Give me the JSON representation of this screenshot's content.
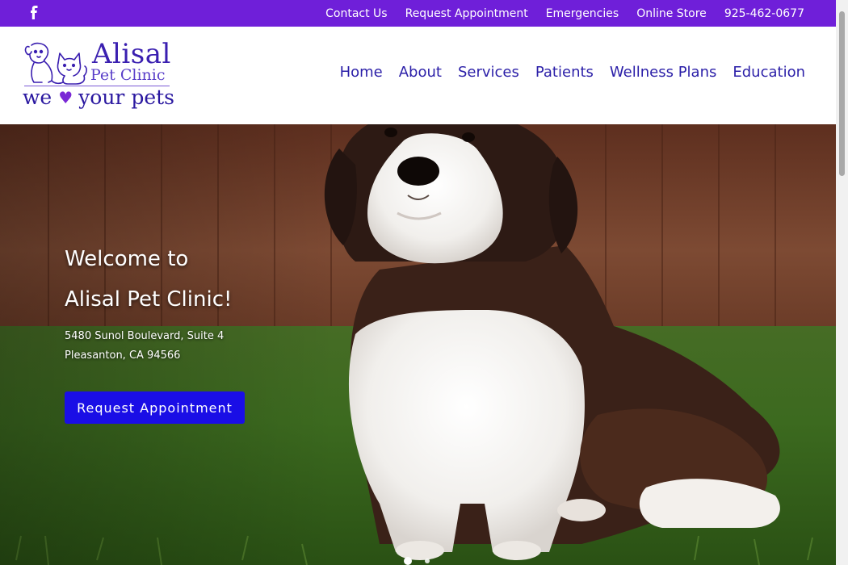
{
  "topbar": {
    "background": "#6f1fd9",
    "facebook_icon": "facebook-icon",
    "links": [
      "Contact Us",
      "Request Appointment",
      "Emergencies",
      "Online Store",
      "925-462-0677"
    ]
  },
  "logo": {
    "name": "Alisal",
    "subtitle": "Pet Clinic",
    "tagline_before": "we",
    "heart_icon": "heart-icon",
    "tagline_after": "your pets",
    "color": "#3a1fb0"
  },
  "nav": {
    "items": [
      "Home",
      "About",
      "Services",
      "Patients",
      "Wellness Plans",
      "Education"
    ],
    "color": "#2b1fa8"
  },
  "hero": {
    "title_line1": "Welcome to",
    "title_line2": "Alisal Pet Clinic!",
    "address_line1": "5480 Sunol Boulevard, Suite 4",
    "address_line2": "Pleasanton, CA 94566",
    "button_label": "Request Appointment",
    "button_color": "#1a0ee6",
    "image": "st-bernard-puppy-on-grass",
    "slide_count": 2,
    "active_slide": 1
  }
}
